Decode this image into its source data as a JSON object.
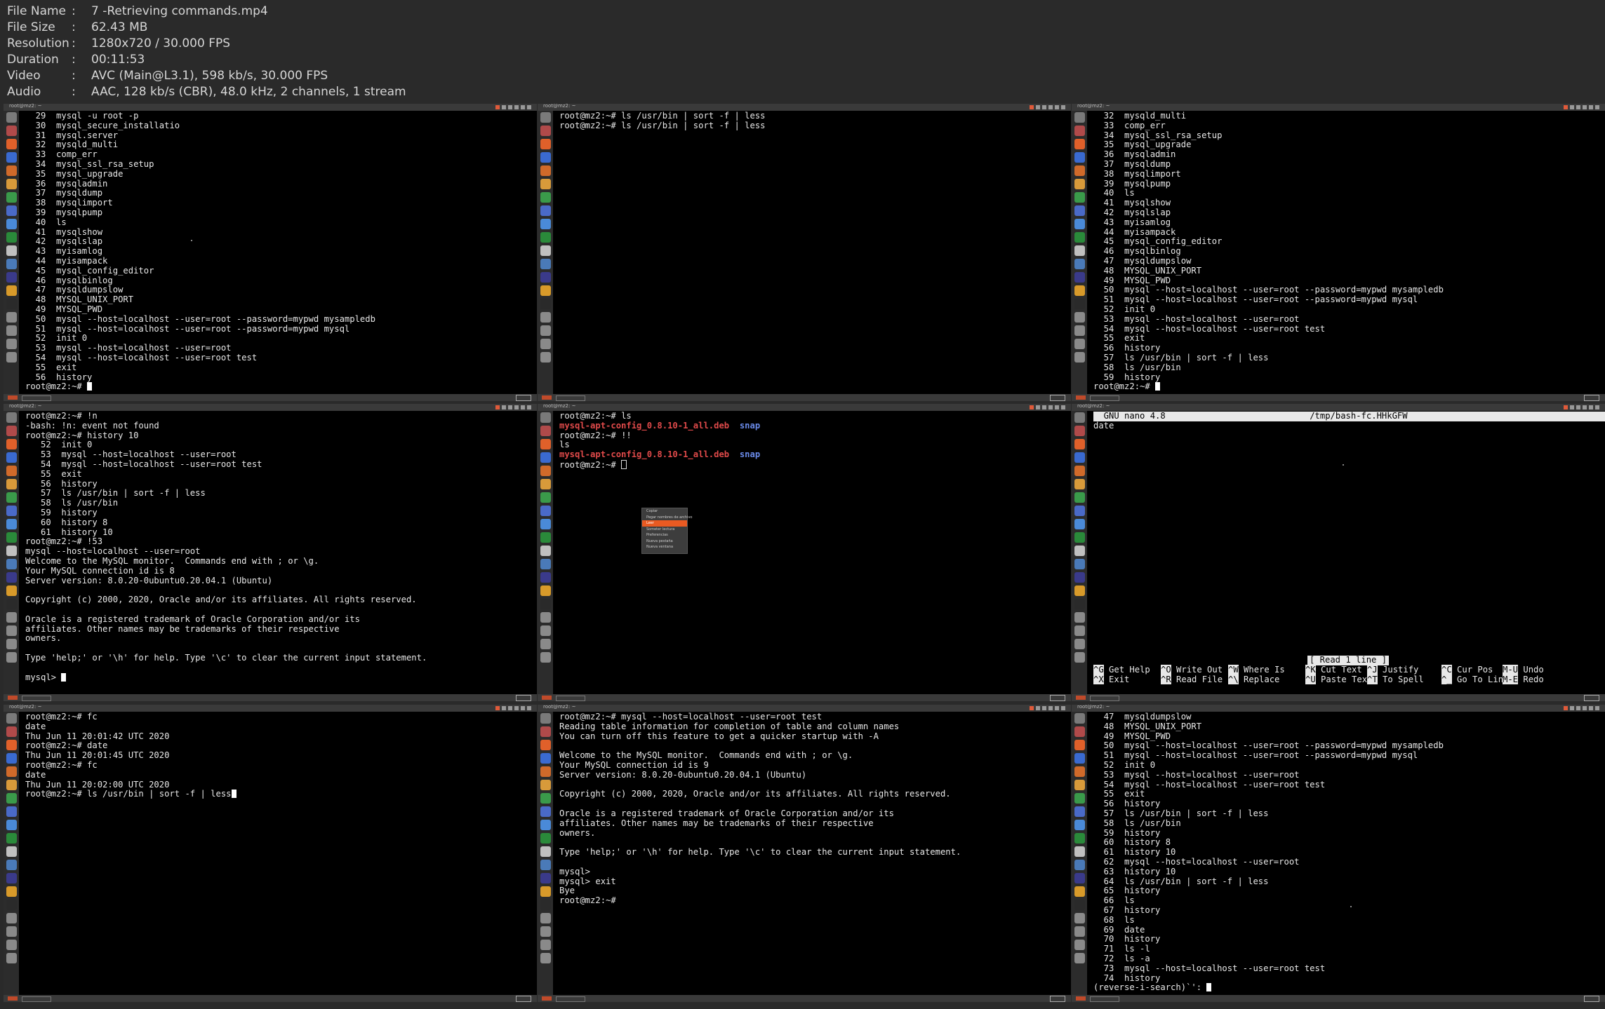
{
  "info": [
    {
      "label": "File Name",
      "value": "7 -Retrieving commands.mp4"
    },
    {
      "label": "File Size",
      "value": "62.43 MB"
    },
    {
      "label": "Resolution",
      "value": "1280x720 / 30.000 FPS"
    },
    {
      "label": "Duration",
      "value": "00:11:53"
    },
    {
      "label": "Video",
      "value": "AVC (Main@L3.1), 598 kb/s, 30.000 FPS"
    },
    {
      "label": "Audio",
      "value": "AAC, 128 kb/s (CBR), 48.0 kHz, 2 channels, 1 stream"
    }
  ],
  "info_sep": ":",
  "window_title": "root@mz2: ~",
  "dock_icon_colors": [
    "#7a7a7a",
    "#b04a4a",
    "#e0602a",
    "#3a6ad0",
    "#d06a2a",
    "#d89a3a",
    "#3a9a4a",
    "#4a6ac8",
    "#4a8ad8",
    "#2a8a3a",
    "#c0c0c0",
    "#4a7ab8",
    "#3a3a8a",
    "#d89a2a",
    "#2a2a2a",
    "#8a8a8a",
    "#8a8a8a",
    "#8a8a8a",
    "#8a8a8a"
  ],
  "tile1": [
    "  29  mysql -u root -p",
    "  30  mysql_secure_installatio",
    "  31  mysql.server",
    "  32  mysqld_multi",
    "  33  comp_err",
    "  34  mysql_ssl_rsa_setup",
    "  35  mysql_upgrade",
    "  36  mysqladmin",
    "  37  mysqldump",
    "  38  mysqlimport",
    "  39  mysqlpump",
    "  40  ls",
    "  41  mysqlshow",
    "  42  mysqlslap",
    "  43  myisamlog",
    "  44  myisampack",
    "  45  mysql_config_editor",
    "  46  mysqlbinlog",
    "  47  mysqldumpslow",
    "  48  MYSQL_UNIX_PORT",
    "  49  MYSQL_PWD",
    "  50  mysql --host=localhost --user=root --password=mypwd mysampledb",
    "  51  mysql --host=localhost --user=root --password=mypwd mysql",
    "  52  init 0",
    "  53  mysql --host=localhost --user=root",
    "  54  mysql --host=localhost --user=root test",
    "  55  exit",
    "  56  history"
  ],
  "tile1_prompt": "root@mz2:~# ",
  "tile2": [
    "root@mz2:~# ls /usr/bin | sort -f | less",
    "root@mz2:~# ls /usr/bin | sort -f | less"
  ],
  "tile3": [
    "  32  mysqld_multi",
    "  33  comp_err",
    "  34  mysql_ssl_rsa_setup",
    "  35  mysql_upgrade",
    "  36  mysqladmin",
    "  37  mysqldump",
    "  38  mysqlimport",
    "  39  mysqlpump",
    "  40  ls",
    "  41  mysqlshow",
    "  42  mysqlslap",
    "  43  myisamlog",
    "  44  myisampack",
    "  45  mysql_config_editor",
    "  46  mysqlbinlog",
    "  47  mysqldumpslow",
    "  48  MYSQL_UNIX_PORT",
    "  49  MYSQL_PWD",
    "  50  mysql --host=localhost --user=root --password=mypwd mysampledb",
    "  51  mysql --host=localhost --user=root --password=mypwd mysql",
    "  52  init 0",
    "  53  mysql --host=localhost --user=root",
    "  54  mysql --host=localhost --user=root test",
    "  55  exit",
    "  56  history",
    "  57  ls /usr/bin | sort -f | less",
    "  58  ls /usr/bin",
    "  59  history"
  ],
  "tile3_prompt": "root@mz2:~# ",
  "tile4": [
    "root@mz2:~# !n",
    "-bash: !n: event not found",
    "root@mz2:~# history 10",
    "   52  init 0",
    "   53  mysql --host=localhost --user=root",
    "   54  mysql --host=localhost --user=root test",
    "   55  exit",
    "   56  history",
    "   57  ls /usr/bin | sort -f | less",
    "   58  ls /usr/bin",
    "   59  history",
    "   60  history 8",
    "   61  history 10",
    "root@mz2:~# !53",
    "mysql --host=localhost --user=root",
    "Welcome to the MySQL monitor.  Commands end with ; or \\g.",
    "Your MySQL connection id is 8",
    "Server version: 8.0.20-0ubuntu0.20.04.1 (Ubuntu)",
    "",
    "Copyright (c) 2000, 2020, Oracle and/or its affiliates. All rights reserved.",
    "",
    "Oracle is a registered trademark of Oracle Corporation and/or its",
    "affiliates. Other names may be trademarks of their respective",
    "owners.",
    "",
    "Type 'help;' or '\\h' for help. Type '\\c' to clear the current input statement.",
    ""
  ],
  "tile4_prompt": "mysql> ",
  "tile5": {
    "prompt": "root@mz2:~# ",
    "cmd1": "ls",
    "file": "mysql-apt-config_0.8.10-1_all.deb",
    "dir": "snap",
    "cmd2": "!!",
    "echo": "ls",
    "gap": "  "
  },
  "context_menu": [
    "Copiar",
    "Pegar nombres de archivo",
    "Leer",
    "Someter lectura",
    "Preferencias",
    "Nueva pestaña",
    "Nueva ventana"
  ],
  "tile6": {
    "head_left": "  GNU nano 4.8",
    "head_right": "/tmp/bash-fc.HHkGFW",
    "body": "date",
    "status": "[ Read 1 line ]",
    "shortcuts": [
      [
        "^G",
        "Get Help"
      ],
      [
        "^O",
        "Write Out"
      ],
      [
        "^W",
        "Where Is"
      ],
      [
        "^K",
        "Cut Text"
      ],
      [
        "^J",
        "Justify"
      ],
      [
        "^C",
        "Cur Pos"
      ],
      [
        "M-U",
        "Undo"
      ],
      [
        "^X",
        "Exit"
      ],
      [
        "^R",
        "Read File"
      ],
      [
        "^\\",
        "Replace"
      ],
      [
        "^U",
        "Paste Text"
      ],
      [
        "^T",
        "To Spell"
      ],
      [
        "^_",
        "Go To Line"
      ],
      [
        "M-E",
        "Redo"
      ]
    ]
  },
  "tile7": [
    "root@mz2:~# fc",
    "date",
    "Thu Jun 11 20:01:42 UTC 2020",
    "root@mz2:~# date",
    "Thu Jun 11 20:01:45 UTC 2020",
    "root@mz2:~# fc",
    "date",
    "Thu Jun 11 20:02:00 UTC 2020"
  ],
  "tile7_prompt": "root@mz2:~# ls /usr/bin | sort -f | less",
  "tile8": [
    "root@mz2:~# mysql --host=localhost --user=root test",
    "Reading table information for completion of table and column names",
    "You can turn off this feature to get a quicker startup with -A",
    "",
    "Welcome to the MySQL monitor.  Commands end with ; or \\g.",
    "Your MySQL connection id is 9",
    "Server version: 8.0.20-0ubuntu0.20.04.1 (Ubuntu)",
    "",
    "Copyright (c) 2000, 2020, Oracle and/or its affiliates. All rights reserved.",
    "",
    "Oracle is a registered trademark of Oracle Corporation and/or its",
    "affiliates. Other names may be trademarks of their respective",
    "owners.",
    "",
    "Type 'help;' or '\\h' for help. Type '\\c' to clear the current input statement.",
    "",
    "mysql>",
    "mysql> exit",
    "Bye",
    "root@mz2:~#"
  ],
  "tile9": [
    "  47  mysqldumpslow",
    "  48  MYSQL_UNIX_PORT",
    "  49  MYSQL_PWD",
    "  50  mysql --host=localhost --user=root --password=mypwd mysampledb",
    "  51  mysql --host=localhost --user=root --password=mypwd mysql",
    "  52  init 0",
    "  53  mysql --host=localhost --user=root",
    "  54  mysql --host=localhost --user=root test",
    "  55  exit",
    "  56  history",
    "  57  ls /usr/bin | sort -f | less",
    "  58  ls /usr/bin",
    "  59  history",
    "  60  history 8",
    "  61  history 10",
    "  62  mysql --host=localhost --user=root",
    "  63  history 10",
    "  64  ls /usr/bin | sort -f | less",
    "  65  history",
    "  66  ls",
    "  67  history",
    "  68  ls",
    "  69  date",
    "  70  history",
    "  71  ls -l",
    "  72  ls -a",
    "  73  mysql --host=localhost --user=root test",
    "  74  history"
  ],
  "tile9_prompt": "(reverse-i-search)`': "
}
